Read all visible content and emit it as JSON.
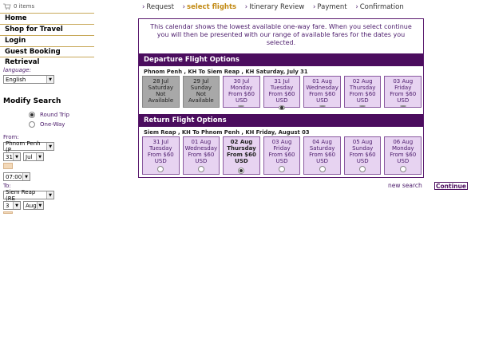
{
  "cart": {
    "count": "0 items"
  },
  "nav": [
    {
      "label": "Home"
    },
    {
      "label": "Shop for Travel"
    },
    {
      "label": "Login"
    },
    {
      "label": "Guest Booking Retrieval"
    }
  ],
  "language": {
    "label": "language:",
    "value": "English"
  },
  "modify": {
    "title": "Modify Search",
    "round_trip": "Round Trip",
    "one_way": "One-Way",
    "from_label": "From:",
    "from_value": "Phnom Penh (P",
    "from_day": "31",
    "from_month": "Jul",
    "time": "07:00",
    "to_label": "To:",
    "to_value": "Siem Reap (RE",
    "to_day": "3",
    "to_month": "Aug"
  },
  "steps": [
    {
      "label": "Request"
    },
    {
      "label": "select flights"
    },
    {
      "label": "Itinerary Review"
    },
    {
      "label": "Payment"
    },
    {
      "label": "Confirmation"
    }
  ],
  "intro": "This calendar shows the lowest available one-way fare. When you select continue you will then be presented with our range of available fares for the dates you selected.",
  "departure": {
    "title": "Departure Flight Options",
    "route": "Phnom Penh , KH To Siem Reap , KH Saturday, July 31",
    "days": [
      {
        "date": "28 Jul",
        "weekday": "Saturday",
        "fare": "Not Available",
        "status": "na"
      },
      {
        "date": "29 Jul",
        "weekday": "Sunday",
        "fare": "Not Available",
        "status": "na"
      },
      {
        "date": "30 Jul",
        "weekday": "Monday",
        "fare": "From $60 USD",
        "status": "open"
      },
      {
        "date": "31 Jul",
        "weekday": "Tuesday",
        "fare": "From $60 USD",
        "status": "selected"
      },
      {
        "date": "01 Aug",
        "weekday": "Wednesday",
        "fare": "From $60 USD",
        "status": "open"
      },
      {
        "date": "02 Aug",
        "weekday": "Thursday",
        "fare": "From $60 USD",
        "status": "open"
      },
      {
        "date": "03 Aug",
        "weekday": "Friday",
        "fare": "From $60 USD",
        "status": "open"
      }
    ]
  },
  "return": {
    "title": "Return Flight Options",
    "route": "Siem Reap , KH To Phnom Penh , KH Friday, August 03",
    "days": [
      {
        "date": "31 Jul",
        "weekday": "Tuesday",
        "fare1": "From $60",
        "fare2": "USD",
        "status": "open"
      },
      {
        "date": "01 Aug",
        "weekday": "Wednesday",
        "fare1": "From $60",
        "fare2": "USD",
        "status": "open"
      },
      {
        "date": "02 Aug",
        "weekday": "Thursday",
        "fare1": "From $60 USD",
        "fare2": "",
        "status": "selected"
      },
      {
        "date": "03 Aug",
        "weekday": "Friday",
        "fare1": "From $60",
        "fare2": "USD",
        "status": "open"
      },
      {
        "date": "04 Aug",
        "weekday": "Saturday",
        "fare1": "From $60",
        "fare2": "USD",
        "status": "open"
      },
      {
        "date": "05 Aug",
        "weekday": "Sunday",
        "fare1": "From $60",
        "fare2": "USD",
        "status": "open"
      },
      {
        "date": "06 Aug",
        "weekday": "Monday",
        "fare1": "From $60",
        "fare2": "USD",
        "status": "open"
      }
    ]
  },
  "actions": {
    "new_search": "new search",
    "continue": "Continue"
  },
  "colors": {
    "brand_purple": "#4b0d5e",
    "accent_gold": "#c28a13",
    "day_bg": "#e7d3f1",
    "na_bg": "#a8a8a8"
  }
}
